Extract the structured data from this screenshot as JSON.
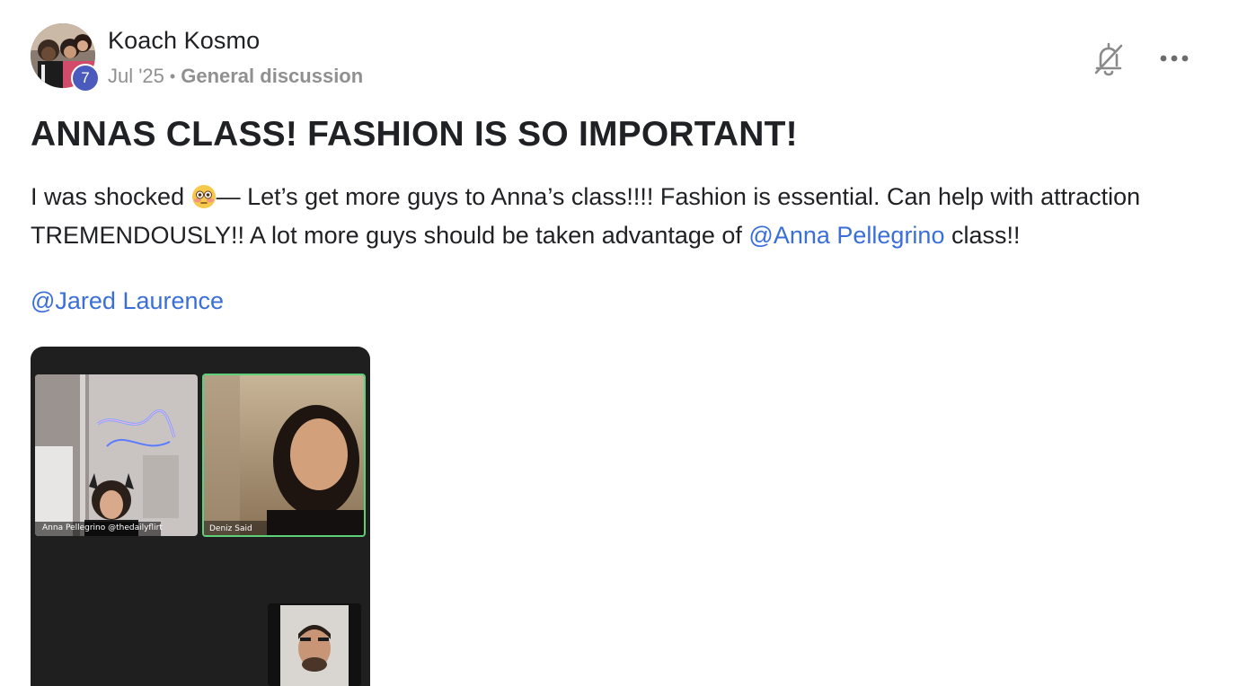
{
  "post": {
    "author": "Koach Kosmo",
    "level": "7",
    "date": "Jul '25",
    "separator": "•",
    "category": "General discussion",
    "title": "ANNAS CLASS! FASHION IS SO IMPORTANT!",
    "body": {
      "text_1": "I was shocked ",
      "emoji": "flushed-face-emoji",
      "text_2": "— Let’s get more guys to Anna’s class!!!! Fashion is essential. Can help with attraction TREMENDOUSLY!! A lot more guys should be taken advantage of ",
      "mention_1": "@Anna Pellegrino",
      "text_3": " class!!"
    },
    "mention_2": "@Jared Laurence",
    "icons": {
      "bell": "bell-off-icon",
      "more": "more-horizontal-icon"
    }
  },
  "attachment": {
    "type": "video-call-screenshot",
    "participants": [
      {
        "label": "Anna Pellegrino @thedailyflirt"
      },
      {
        "label": "Deniz Said"
      }
    ]
  },
  "colors": {
    "mention": "#3b6fd8",
    "badge": "#4a5bbd",
    "meta": "#909090",
    "active_speaker_border": "#5fd07a"
  }
}
